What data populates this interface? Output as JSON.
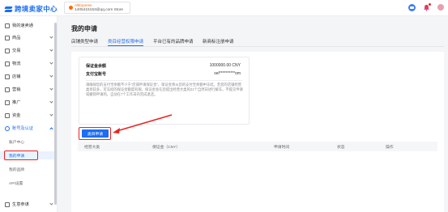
{
  "header": {
    "logo_text": "跨境卖家中心",
    "store_tag": "AliExpress",
    "store_email": "1405415153@qq.com Store"
  },
  "sidebar": {
    "items": [
      {
        "label": "我的速卖通",
        "chevron": false
      },
      {
        "label": "商品",
        "chevron": true
      },
      {
        "label": "交易",
        "chevron": true
      },
      {
        "label": "物流",
        "chevron": true
      },
      {
        "label": "店铺",
        "chevron": true
      },
      {
        "label": "营销",
        "chevron": true
      },
      {
        "label": "推广",
        "chevron": true
      },
      {
        "label": "资金",
        "chevron": true
      },
      {
        "label": "账号及认证",
        "chevron": true,
        "expanded": true
      }
    ],
    "sub_items": [
      {
        "label": "账户中心",
        "selected": false
      },
      {
        "label": "我的申请",
        "selected": true
      },
      {
        "label": "我的品牌",
        "selected": false
      },
      {
        "label": "API设置",
        "selected": false
      }
    ],
    "bottom_item": {
      "label": "生意参谋"
    }
  },
  "main": {
    "title": "我的申请",
    "tabs": [
      {
        "label": "店铺类型申请",
        "active": false
      },
      {
        "label": "类目经营权限申请",
        "active": true
      },
      {
        "label": "平台已有的品牌申请",
        "active": false
      },
      {
        "label": "新商标注册申请",
        "active": false
      }
    ],
    "info": {
      "deposit_label": "保证金余额",
      "deposit_value": "1000000.00 CNY",
      "alipay_label": "支付宝账号",
      "alipay_value": "sel**********om",
      "notes": "请确保您的支付宝余额不少于“店铺申请保证金”，保证金将从您的支付宝余额中冻结。若您的店铺经营类目较多，可冻结的保证金额度有限，保证金会在您提出经营大类的21个自然日进行解冻，不提交申请或撤销申请的，自动在7个工作日内完成退还。"
    },
    "apply_button": "类目申请",
    "table_headers": [
      "经营大类",
      "保证金（CNY）",
      "申请时间",
      "状态",
      "操作"
    ]
  },
  "colors": {
    "accent": "#1d6ef0",
    "highlight": "#e22222",
    "store_tag": "#ff6a00"
  }
}
